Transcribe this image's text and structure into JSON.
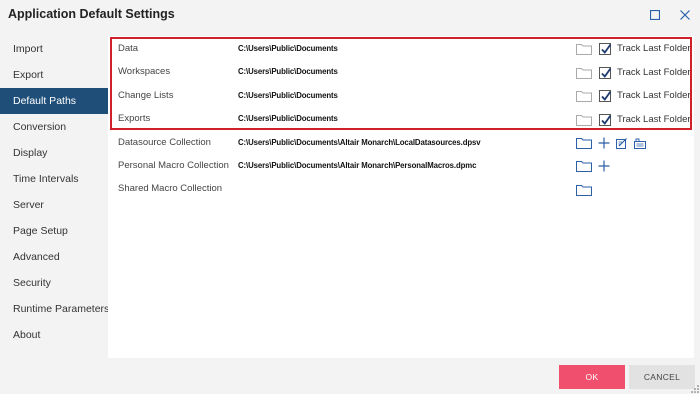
{
  "window": {
    "title": "Application Default Settings"
  },
  "sidebar": {
    "items": [
      {
        "label": "Import"
      },
      {
        "label": "Export"
      },
      {
        "label": "Default Paths",
        "active": true
      },
      {
        "label": "Conversion"
      },
      {
        "label": "Display"
      },
      {
        "label": "Time Intervals"
      },
      {
        "label": "Server"
      },
      {
        "label": "Page Setup"
      },
      {
        "label": "Advanced"
      },
      {
        "label": "Security"
      },
      {
        "label": "Runtime Parameters"
      },
      {
        "label": "About"
      }
    ]
  },
  "paths": {
    "rows": [
      {
        "label": "Data",
        "value": "C:\\Users\\Public\\Documents",
        "track_last_folder": true
      },
      {
        "label": "Workspaces",
        "value": "C:\\Users\\Public\\Documents",
        "track_last_folder": true
      },
      {
        "label": "Change Lists",
        "value": "C:\\Users\\Public\\Documents",
        "track_last_folder": true
      },
      {
        "label": "Exports",
        "value": "C:\\Users\\Public\\Documents",
        "track_last_folder": true
      },
      {
        "label": "Datasource Collection",
        "value": "C:\\Users\\Public\\Documents\\Altair Monarch\\LocalDatasources.dpsv"
      },
      {
        "label": "Personal Macro Collection",
        "value": "C:\\Users\\Public\\Documents\\Altair Monarch\\PersonalMacros.dpmc"
      },
      {
        "label": "Shared Macro Collection",
        "value": ""
      }
    ],
    "track_label": "Track Last Folder"
  },
  "footer": {
    "ok_label": "OK",
    "cancel_label": "CANCEL"
  },
  "colors": {
    "accent_nav": "#1f4e79",
    "ok_button": "#f0506e",
    "highlight_border": "#d0202a",
    "window_icons": "#2b5fa8"
  },
  "icons": [
    "maximize-icon",
    "close-icon",
    "folder-icon",
    "checkbox-checked",
    "plus-icon",
    "edit-datasource-icon",
    "manage-datasource-icon",
    "resize-grip-icon"
  ]
}
